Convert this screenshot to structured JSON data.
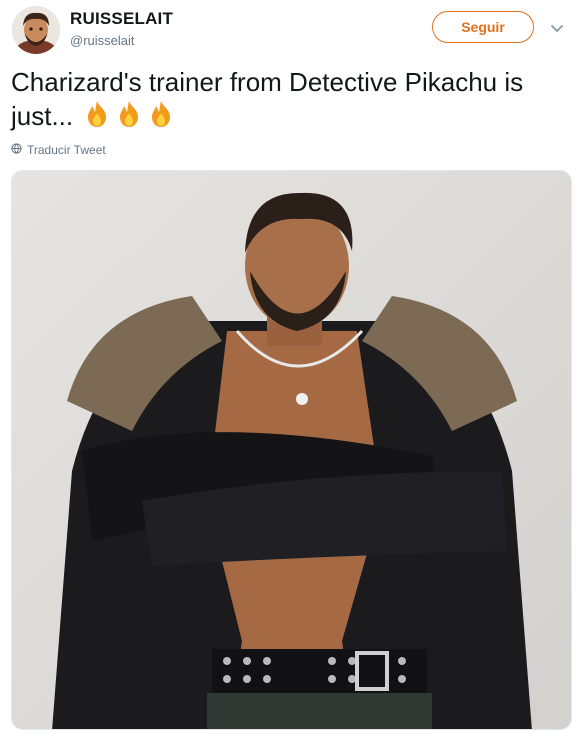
{
  "user": {
    "display_name": "RUISSELAIT",
    "handle": "@ruisselait",
    "avatar_icon": "avatar"
  },
  "follow_button": {
    "label": "Seguir",
    "color": "#e0701c"
  },
  "menu_icon": "chevron-down-icon",
  "tweet": {
    "text": "Charizard's trainer from Detective Pikachu is just...",
    "emoji": [
      "fire",
      "fire",
      "fire"
    ]
  },
  "translate": {
    "label": "Traducir Tweet",
    "icon": "globe-icon"
  },
  "media": {
    "icon": "tweet-image"
  },
  "colors": {
    "accent": "#e0701c",
    "text": "#14171a",
    "secondary": "#657786"
  }
}
